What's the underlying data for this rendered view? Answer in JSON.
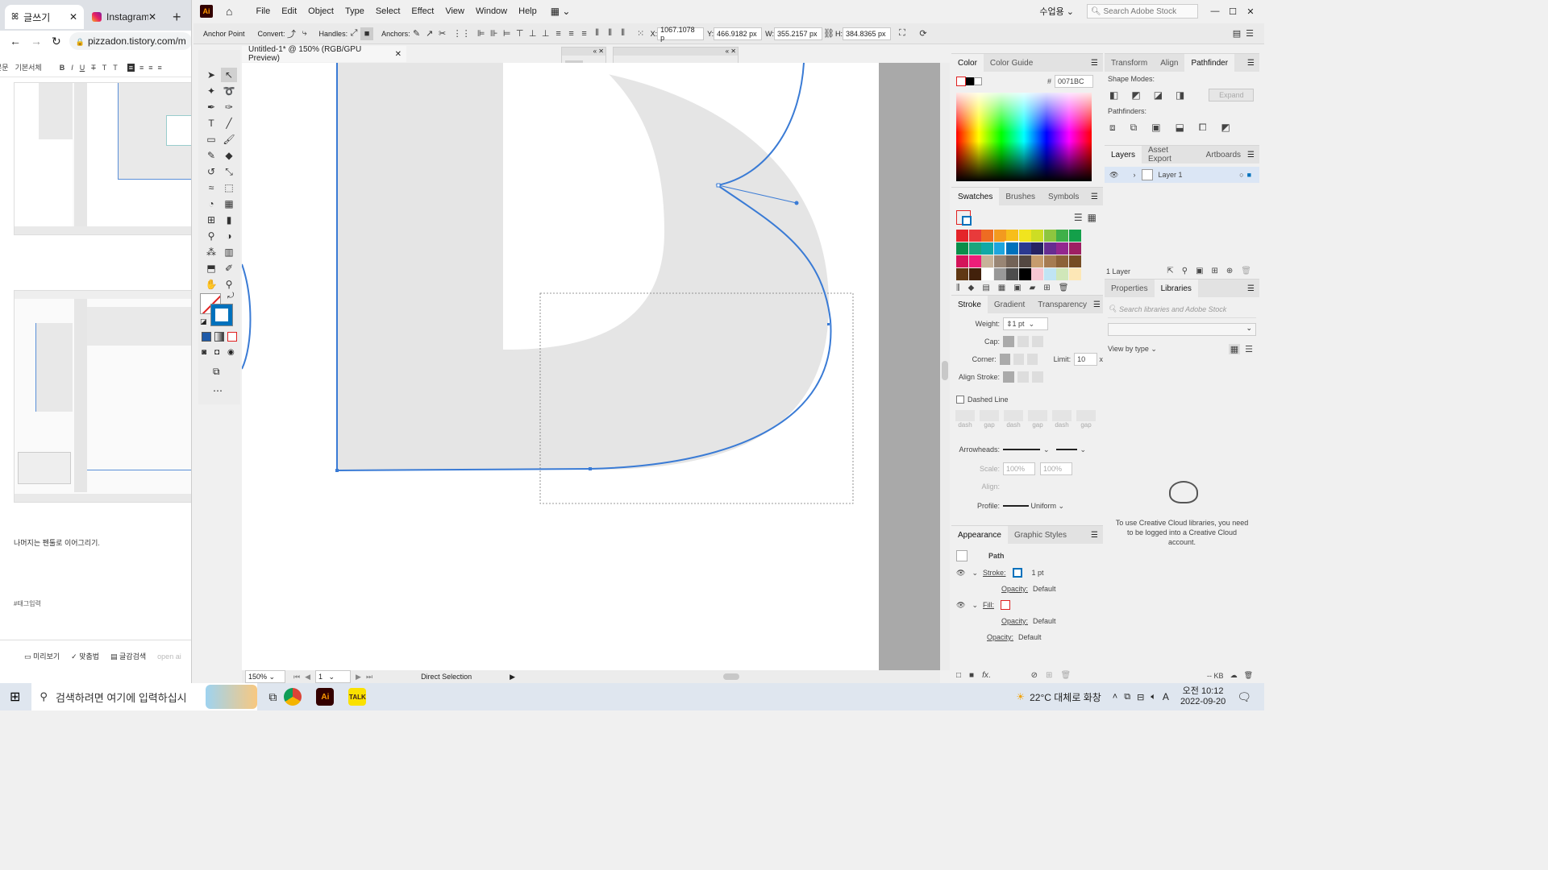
{
  "browser": {
    "tabs": [
      {
        "label": "글쓰기",
        "active": true
      },
      {
        "label": "Instagram",
        "active": false
      }
    ],
    "new_tab": "+",
    "url": "pizzadon.tistory.com/m",
    "editor_font": "기본서체",
    "editor_style_prefix": "본문",
    "body_text": "나머지는 펜툴로 이어그리기.",
    "tag_placeholder": "#태그입력",
    "bottom_buttons": [
      "미리보기",
      "맞춤법",
      "글감검색"
    ],
    "bottom_extra": "open ai"
  },
  "illustrator": {
    "logo": "Ai",
    "menu": [
      "File",
      "Edit",
      "Object",
      "Type",
      "Select",
      "Effect",
      "View",
      "Window",
      "Help"
    ],
    "workspace": "수업용",
    "search_placeholder": "Search Adobe Stock",
    "control": {
      "anchor_point": "Anchor Point",
      "convert": "Convert:",
      "handles": "Handles:",
      "anchors": "Anchors:",
      "x_label": "X:",
      "x": "1067.1078 p",
      "y_label": "Y:",
      "y": "466.9182 px",
      "w_label": "W:",
      "w": "355.2157 px",
      "h_label": "H:",
      "h": "384.8365 px"
    },
    "document_tab": "Untitled-1* @ 150% (RGB/GPU Preview)",
    "status": {
      "zoom": "150%",
      "artboard": "1",
      "tool": "Direct Selection"
    },
    "color_panel": {
      "tabs": [
        "Color",
        "Color Guide"
      ],
      "hex_label": "#",
      "hex": "0071BC"
    },
    "swatches_panel": {
      "tabs": [
        "Swatches",
        "Brushes",
        "Symbols"
      ],
      "colors": [
        "#e4252a",
        "#e83a3b",
        "#ee6c22",
        "#f39a1f",
        "#f7be1a",
        "#f1e41e",
        "#cddd24",
        "#8dc63f",
        "#3fb049",
        "#13a04a",
        "#0a8e4a",
        "#1aa57d",
        "#11a8a6",
        "#1ea5dd",
        "#0071bc",
        "#2b3990",
        "#262262",
        "#662d91",
        "#93278f",
        "#9e1f63",
        "#d4145a",
        "#ed1e79",
        "#c7b299",
        "#998675",
        "#736357",
        "#534741",
        "#c69c6d",
        "#a67c52",
        "#8c6239",
        "#754c24",
        "#603813",
        "#42210b",
        "#ffffff",
        "#999999",
        "#4d4d4d",
        "#000000",
        "#f8c6d2",
        "#c0e4f4",
        "#d0e7b9",
        "#fde7b6"
      ]
    },
    "stroke_panel": {
      "tabs": [
        "Stroke",
        "Gradient",
        "Transparency"
      ],
      "weight_label": "Weight:",
      "weight": "1 pt",
      "cap_label": "Cap:",
      "corner_label": "Corner:",
      "limit_label": "Limit:",
      "limit": "10",
      "limit_unit": "x",
      "align_label": "Align Stroke:",
      "dashed_label": "Dashed Line",
      "dash_labels": [
        "dash",
        "gap",
        "dash",
        "gap",
        "dash",
        "gap"
      ],
      "arrowheads_label": "Arrowheads:",
      "scale_label": "Scale:",
      "scale1": "100%",
      "scale2": "100%",
      "align2_label": "Align:",
      "profile_label": "Profile:",
      "profile": "Uniform"
    },
    "appearance_panel": {
      "tabs": [
        "Appearance",
        "Graphic Styles"
      ],
      "object": "Path",
      "stroke_label": "Stroke:",
      "stroke_value": "1 pt",
      "opacity_label": "Opacity:",
      "opacity_value": "Default",
      "fill_label": "Fill:",
      "opacity2_label": "Opacity:",
      "opacity2_value": "Default",
      "opacity3_label": "Opacity:",
      "opacity3_value": "Default"
    },
    "pathfinder_panel": {
      "tabs": [
        "Transform",
        "Align",
        "Pathfinder"
      ],
      "shape_modes": "Shape Modes:",
      "expand": "Expand",
      "pathfinders": "Pathfinders:"
    },
    "layers_panel": {
      "tabs": [
        "Layers",
        "Asset Export",
        "Artboards"
      ],
      "layer_name": "Layer 1",
      "count": "1 Layer"
    },
    "libraries_panel": {
      "tabs": [
        "Properties",
        "Libraries"
      ],
      "search_placeholder": "Search libraries and Adobe Stock",
      "view_by": "View by type",
      "message": "To use Creative Cloud libraries, you need to be logged into a Creative Cloud account.",
      "kb": "-- KB"
    }
  },
  "taskbar": {
    "search_placeholder": "검색하려면 여기에 입력하십시",
    "weather": "22°C 대체로 화창",
    "ime": "A",
    "time": "오전 10:12",
    "date": "2022-09-20"
  }
}
